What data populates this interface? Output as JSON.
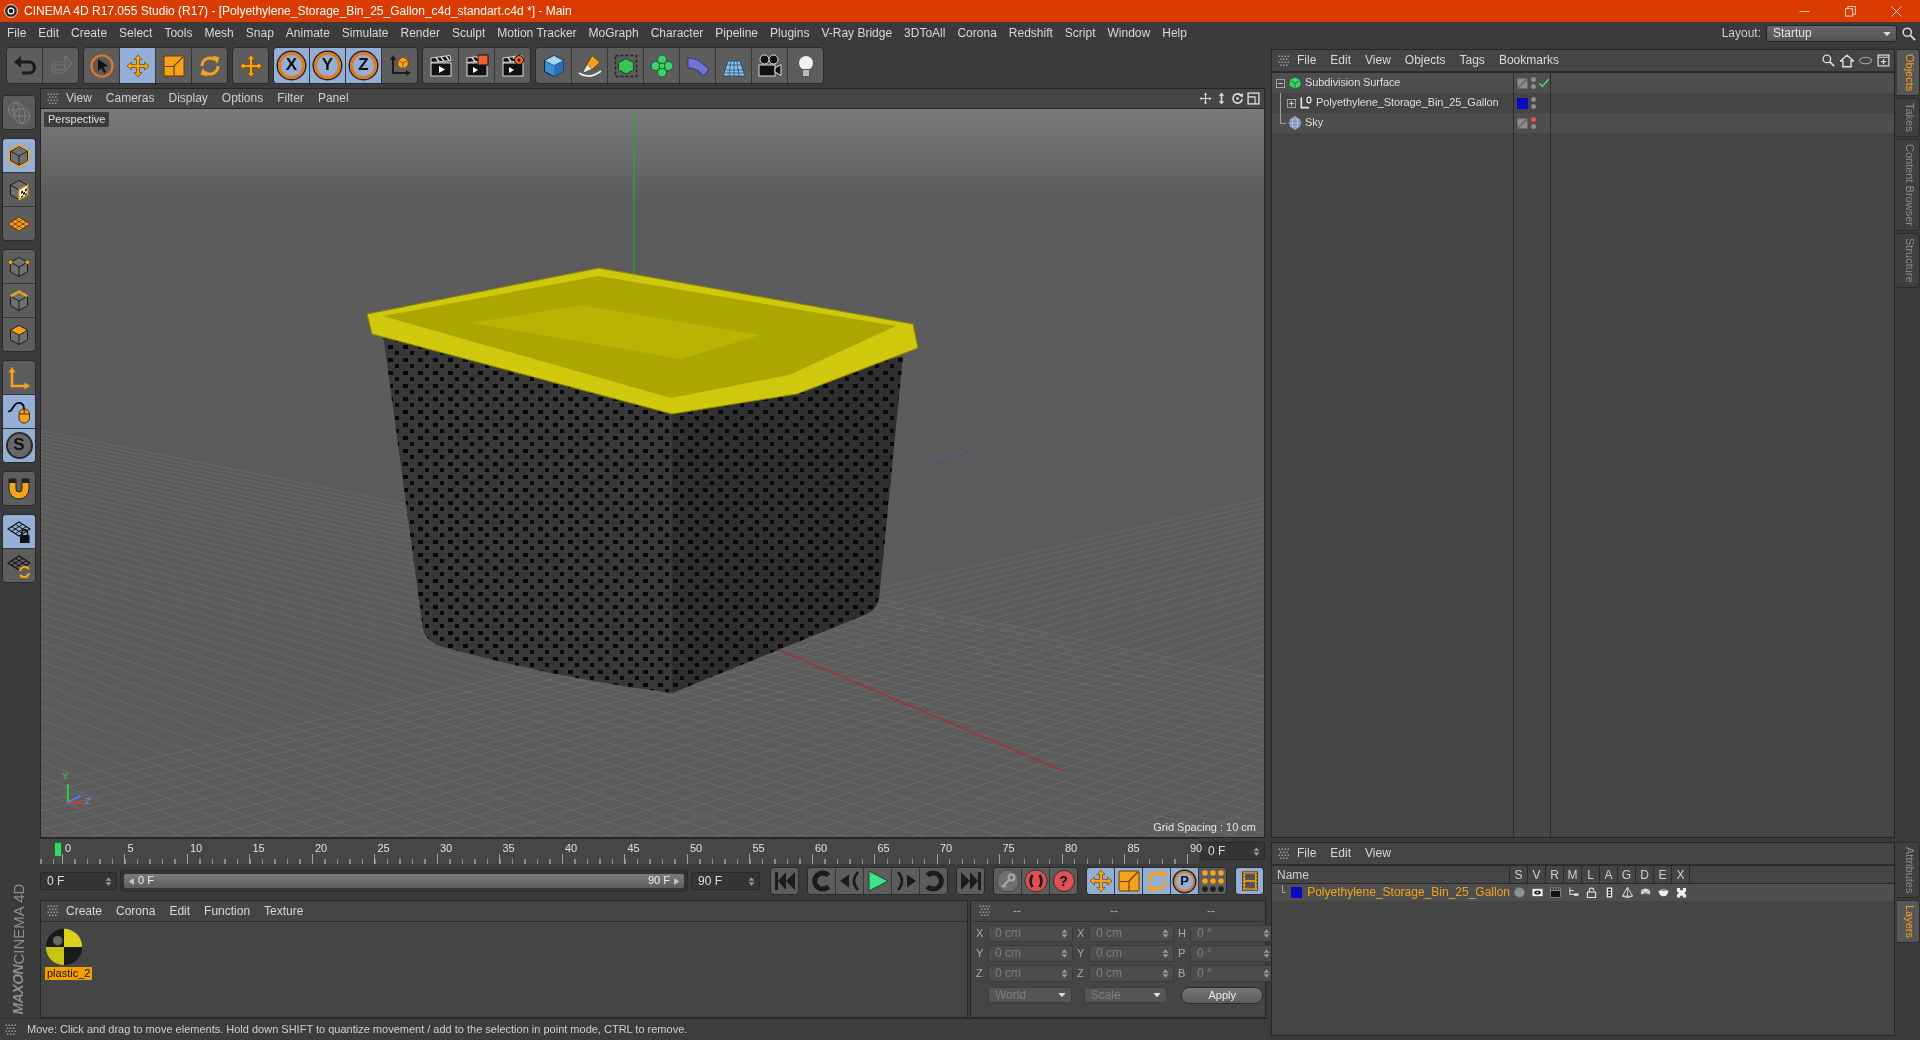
{
  "window": {
    "title": "CINEMA 4D R17.055 Studio (R17) - [Polyethylene_Storage_Bin_25_Gallon_c4d_standart.c4d *] - Main"
  },
  "menu_bar": {
    "items": [
      "File",
      "Edit",
      "Create",
      "Select",
      "Tools",
      "Mesh",
      "Snap",
      "Animate",
      "Simulate",
      "Render",
      "Sculpt",
      "Motion Tracker",
      "MoGraph",
      "Character",
      "Pipeline",
      "Plugins",
      "V-Ray Bridge",
      "3DToAll",
      "Corona",
      "Redshift",
      "Script",
      "Window",
      "Help"
    ],
    "layout_label": "Layout:",
    "layout_value": "Startup"
  },
  "toolbar": {
    "groups": [
      {
        "items": [
          {
            "selected": false,
            "disabled": false
          },
          {
            "selected": false,
            "disabled": true
          }
        ]
      },
      {
        "items": [
          {
            "selected": false
          },
          {
            "selected": true
          },
          {
            "selected": false
          },
          {
            "selected": false
          }
        ]
      },
      {
        "items": [
          {
            "selected": false
          }
        ]
      },
      {
        "items": [
          {
            "label": "X",
            "selected": true
          },
          {
            "label": "Y",
            "selected": true
          },
          {
            "label": "Z",
            "selected": true
          },
          {
            "selected": false
          }
        ]
      },
      {
        "items": [
          {
            "selected": false
          },
          {
            "selected": false
          },
          {
            "selected": false
          }
        ]
      },
      {
        "items": [
          {
            "selected": false
          },
          {
            "selected": false
          },
          {
            "selected": false
          },
          {
            "selected": false
          },
          {
            "selected": false
          },
          {
            "selected": false
          },
          {
            "selected": false
          },
          {
            "selected": false
          }
        ]
      }
    ]
  },
  "tool_palette": {
    "groups": [
      {
        "items": [
          {
            "selected": false,
            "disabled": true
          }
        ]
      },
      {
        "items": [
          {
            "selected": true
          },
          {
            "selected": false
          },
          {
            "selected": false
          }
        ]
      },
      {
        "items": [
          {
            "selected": false
          },
          {
            "selected": false
          },
          {
            "selected": false
          }
        ]
      },
      {
        "items": [
          {
            "selected": false
          },
          {
            "selected": true
          },
          {
            "label": "S",
            "selected": true
          }
        ]
      },
      {
        "items": [
          {
            "selected": false
          }
        ]
      },
      {
        "items": [
          {
            "selected": true
          },
          {
            "selected": false
          }
        ]
      }
    ]
  },
  "viewport": {
    "menu": [
      "View",
      "Cameras",
      "Display",
      "Options",
      "Filter",
      "Panel"
    ],
    "camera": "Perspective",
    "grid_spacing": "Grid Spacing : 10 cm",
    "axis_labels": [
      "Y",
      "Z"
    ]
  },
  "timeline": {
    "ticks": [
      "0",
      "5",
      "10",
      "15",
      "20",
      "25",
      "30",
      "35",
      "40",
      "45",
      "50",
      "55",
      "60",
      "65",
      "70",
      "75",
      "80",
      "85",
      "90"
    ],
    "playhead": {
      "level": 0
    },
    "current_frame": "0 F",
    "start_field": "0 F",
    "range": {
      "level": 1
    },
    "range_start": "0 F",
    "range_end": "90 F",
    "end_field": "90 F"
  },
  "transport": {
    "groups": [
      {
        "items": [
          {
            "selected": false
          }
        ]
      },
      {
        "items": [
          {
            "selected": false
          },
          {
            "selected": false
          },
          {
            "selected": false
          },
          {
            "selected": false
          },
          {
            "selected": false
          }
        ]
      },
      {
        "items": [
          {
            "selected": false
          }
        ]
      },
      {
        "items": [
          {
            "selected": false
          },
          {
            "selected": false
          },
          {
            "label": "?",
            "selected": false
          }
        ]
      },
      {
        "items": [
          {
            "selected": true
          },
          {
            "selected": true
          },
          {
            "selected": true
          },
          {
            "label": "P",
            "selected": true
          },
          {
            "selected": false
          }
        ]
      },
      {
        "items": [
          {
            "selected": true
          }
        ]
      }
    ]
  },
  "materials": {
    "menu": [
      "Create",
      "Corona",
      "Edit",
      "Function",
      "Texture"
    ],
    "items": [
      {
        "name": "plastic_2",
        "selected": true
      }
    ]
  },
  "coordinates": {
    "disabled": true,
    "headers": [
      "--",
      "--",
      "--"
    ],
    "rows": [
      {
        "cells": [
          {
            "label": "X",
            "value": "0 cm"
          },
          {
            "label": "X",
            "value": "0 cm"
          },
          {
            "label": "H",
            "value": "0 °"
          }
        ]
      },
      {
        "cells": [
          {
            "label": "Y",
            "value": "0 cm"
          },
          {
            "label": "Y",
            "value": "0 cm"
          },
          {
            "label": "P",
            "value": "0 °"
          }
        ]
      },
      {
        "cells": [
          {
            "label": "Z",
            "value": "0 cm"
          },
          {
            "label": "Z",
            "value": "0 cm"
          },
          {
            "label": "B",
            "value": "0 °"
          }
        ]
      }
    ],
    "position_mode": "World",
    "size_mode": "Scale",
    "apply": "Apply"
  },
  "logo": {
    "lines": [
      "MAXON",
      "CINEMA 4D"
    ]
  },
  "status_bar": {
    "text": "Move: Click and drag to move elements. Hold down SHIFT to quantize movement / add to the selection in point mode, CTRL to remove."
  },
  "object_manager": {
    "menu": [
      "File",
      "Edit",
      "View",
      "Objects",
      "Tags",
      "Bookmarks"
    ],
    "tree": [
      {
        "kind": "generator",
        "name": "Subdivision Surface",
        "expanded": true,
        "editor_hidden": false,
        "enabled": true,
        "children": [
          {
            "kind": "null",
            "name": "Polyethylene_Storage_Bin_25_Gallon",
            "expanded": false,
            "editor_hidden": false,
            "color": "#0a0ac0"
          }
        ]
      },
      {
        "kind": "sky",
        "name": "Sky",
        "editor_hidden": true
      }
    ]
  },
  "layers": {
    "menu": [
      "File",
      "Edit",
      "View"
    ],
    "columns": [
      "Name",
      "S",
      "V",
      "R",
      "M",
      "L",
      "A",
      "G",
      "D",
      "E",
      "X"
    ],
    "rows": [
      {
        "name": "Polyethylene_Storage_Bin_25_Gallon",
        "color": "#0a0ac0",
        "selected": true
      }
    ]
  },
  "side_tabs": {
    "top": [
      {
        "label": "Objects",
        "selected": true
      },
      {
        "label": "Takes",
        "selected": false
      },
      {
        "label": "Content Browser",
        "selected": false
      },
      {
        "label": "Structure",
        "selected": false
      }
    ],
    "bottom": [
      {
        "label": "Attributes",
        "selected": false
      },
      {
        "label": "Layers",
        "selected": true
      }
    ]
  }
}
